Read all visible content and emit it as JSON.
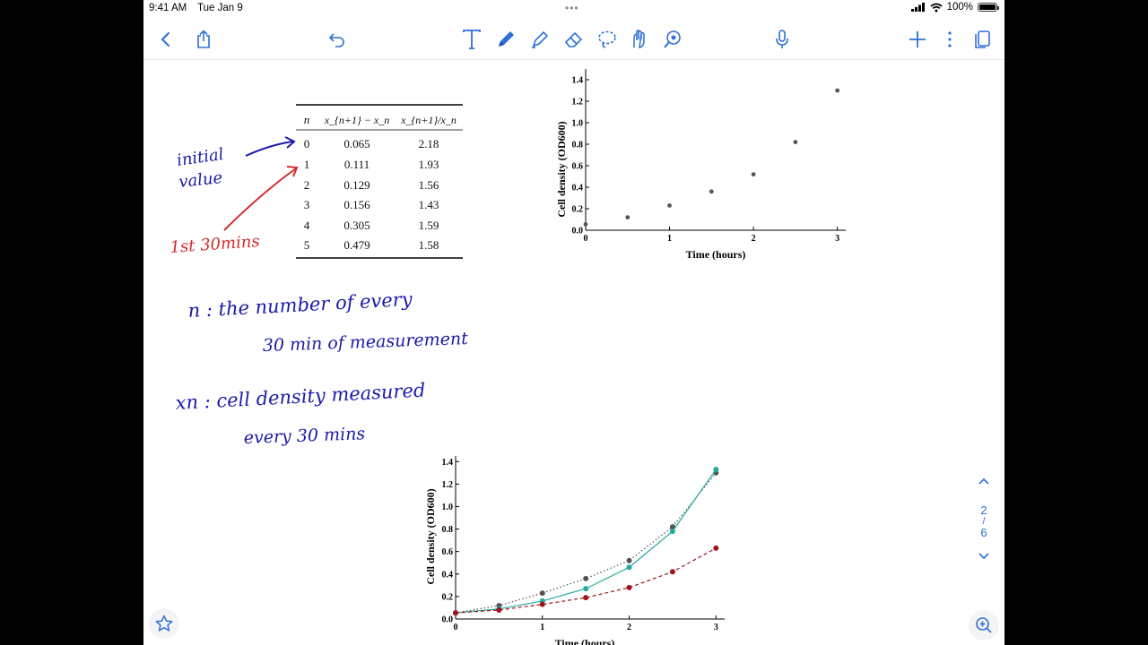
{
  "status": {
    "time": "9:41 AM",
    "date": "Tue Jan 9",
    "battery": "100%",
    "dots": "•••"
  },
  "toolbar": {
    "icons": [
      "chevron-left",
      "share",
      "undo",
      "text-tool",
      "pen-tool",
      "highlighter-tool",
      "eraser-tool",
      "lasso-tool",
      "shapes-tool",
      "laser-pointer-tool",
      "microphone",
      "add",
      "more",
      "page-view"
    ]
  },
  "table": {
    "headers": [
      "n",
      "x_{n+1} − x_n",
      "x_{n+1}/x_n"
    ],
    "rows": [
      [
        "0",
        "0.065",
        "2.18"
      ],
      [
        "1",
        "0.111",
        "1.93"
      ],
      [
        "2",
        "0.129",
        "1.56"
      ],
      [
        "3",
        "0.156",
        "1.43"
      ],
      [
        "4",
        "0.305",
        "1.59"
      ],
      [
        "5",
        "0.479",
        "1.58"
      ]
    ]
  },
  "annotations": {
    "initial_value_line1": "initial",
    "initial_value_line2": "value",
    "first_30": "1st 30mins",
    "n_def_line1": "n : the number of every",
    "n_def_line2": "30 min of measurement",
    "xn_def_line1": "xn : cell density measured",
    "xn_def_line2": "every 30 mins"
  },
  "pager": {
    "current": "2",
    "separator": "/",
    "total": "6"
  },
  "chart_data": [
    {
      "type": "scatter",
      "xlabel": "Time (hours)",
      "ylabel": "Cell density (OD600)",
      "xlim": [
        0,
        3.1
      ],
      "ylim": [
        0,
        1.5
      ],
      "xticks": [
        "0",
        "1",
        "2",
        "3"
      ],
      "yticks": [
        "0.0",
        "0.2",
        "0.4",
        "0.6",
        "0.8",
        "1.0",
        "1.2",
        "1.4"
      ],
      "series": [
        {
          "x": [
            0,
            0.5,
            1,
            1.5,
            2,
            2.5,
            3
          ],
          "values": [
            0.055,
            0.12,
            0.23,
            0.36,
            0.52,
            0.82,
            1.3
          ],
          "color": "#555555"
        }
      ]
    },
    {
      "type": "line",
      "xlabel": "Time (hours)",
      "ylabel": "Cell density (OD600)",
      "xlim": [
        0,
        3.1
      ],
      "ylim": [
        0,
        1.45
      ],
      "xticks": [
        "0",
        "1",
        "2",
        "3"
      ],
      "yticks": [
        "0.0",
        "0.2",
        "0.4",
        "0.6",
        "0.8",
        "1.0",
        "1.2",
        "1.4"
      ],
      "series": [
        {
          "x": [
            0,
            0.5,
            1,
            1.5,
            2,
            2.5,
            3
          ],
          "values": [
            0.055,
            0.12,
            0.23,
            0.36,
            0.52,
            0.82,
            1.3
          ],
          "color": "#555555",
          "style": "dotted"
        },
        {
          "x": [
            0,
            0.5,
            1,
            1.5,
            2,
            2.5,
            3
          ],
          "values": [
            0.055,
            0.09,
            0.16,
            0.27,
            0.46,
            0.78,
            1.33
          ],
          "color": "#23a9a0",
          "style": "solid"
        },
        {
          "x": [
            0,
            0.5,
            1,
            1.5,
            2,
            2.5,
            3
          ],
          "values": [
            0.055,
            0.08,
            0.13,
            0.19,
            0.28,
            0.42,
            0.63
          ],
          "color": "#a0141c",
          "style": "dashed"
        }
      ]
    }
  ],
  "colors": {
    "accent": "#2f6fd6",
    "ink_blue": "#1a1aa8",
    "ink_red": "#d42a2a"
  }
}
